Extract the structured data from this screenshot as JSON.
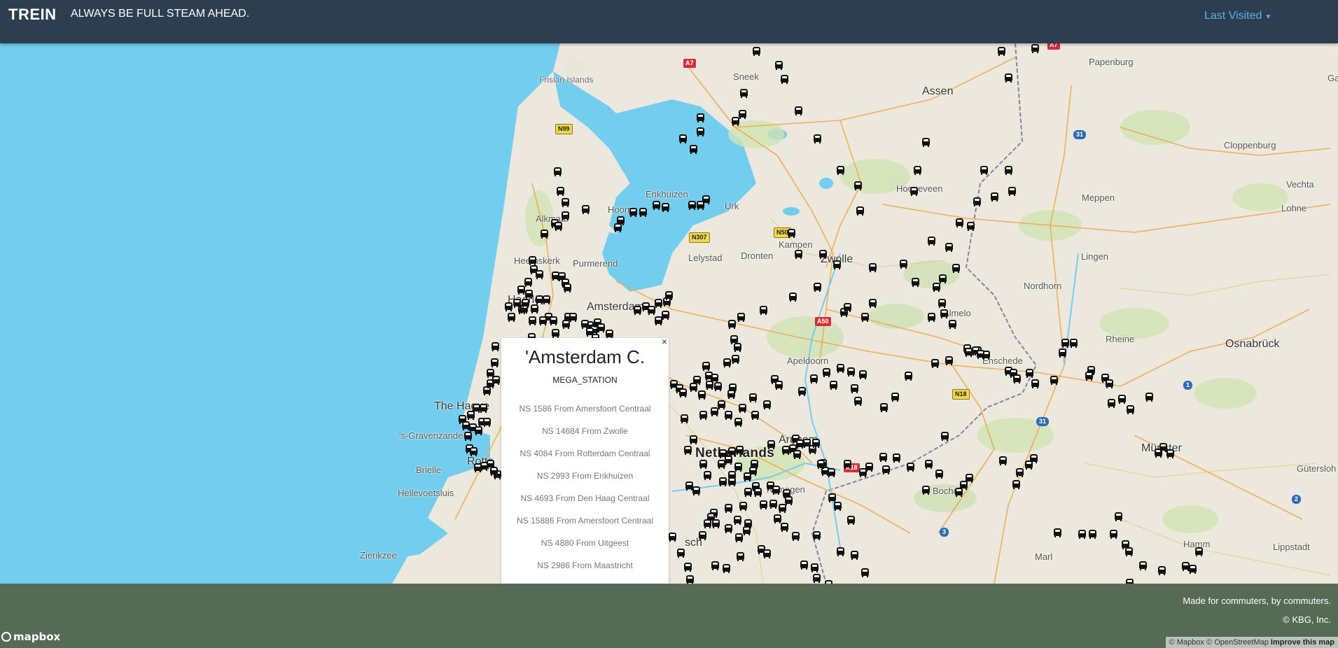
{
  "header": {
    "brand": "TREIN",
    "tagline": "ALWAYS BE FULL STEAM AHEAD.",
    "last_visited": "Last Visited"
  },
  "popup": {
    "close": "×",
    "title": "'Amsterdam C.",
    "type": "MEGA_STATION",
    "trains": [
      "NS 1586 From Amersfoort Centraal",
      "NS 14684 From Zwolle",
      "NS 4084 From Rotterdam Centraal",
      "NS 2993 From Enkhuizen",
      "NS 4693 From Den Haag Centraal",
      "NS 15886 From Amersfoort Centraal",
      "NS 4880 From Uitgeest",
      "NS 2986 From Maastricht"
    ]
  },
  "map": {
    "places": {
      "frisian_islands": "Frisian Islands",
      "sneek": "Sneek",
      "assen": "Assen",
      "papenburg": "Papenburg",
      "cloppenburg": "Cloppenburg",
      "vechta": "Vechta",
      "lohne": "Lohne",
      "meppen": "Meppen",
      "hoogeveen": "Hoogeveen",
      "enkhuizen": "Enkhuizen",
      "hoorn": "Hoorn",
      "urk": "Urk",
      "alkmaar": "Alkmaar",
      "lingen": "Lingen",
      "kampen": "Kampen",
      "zwolle": "Zwolle",
      "dronten": "Dronten",
      "lelystad": "Lelystad",
      "heemskerk": "Heemskerk",
      "purmerend": "Purmerend",
      "nordhorn": "Nordhorn",
      "haarlem": "Haarlem",
      "amsterdam": "Amsterdam",
      "almelo": "Almelo",
      "rheine": "Rheine",
      "osnabruck": "Osnabrück",
      "apeldoorn": "Apeldoorn",
      "enschede": "Enschede",
      "the_hague": "The Hague",
      "gravenzande": "'s-Gravenzande",
      "netherlands": "Netherlands",
      "arnhem": "Arnhem",
      "munster": "Münster",
      "gutersloh": "Gütersloh",
      "brielle": "Brielle",
      "rotterdam": "Rotte",
      "nijmegen": "Nijmegen",
      "bocholt": "Bocholt",
      "hellevoetsluis": "Hellevoetsluis",
      "zierikzee": "Zierikzee",
      "wesel": "sch",
      "marl": "Marl",
      "hamm": "Hamm",
      "lippstadt": "Lippstadt",
      "ga": "Ga"
    },
    "shields": {
      "a7_top": "A7",
      "a7_top2": "A7",
      "n99": "N99",
      "n307": "N307",
      "n50": "N50",
      "a50": "A50",
      "n18": "N18",
      "a18": "A18",
      "r31_1": "31",
      "r31_2": "31",
      "r1": "1",
      "r2": "2",
      "r3": "3"
    }
  },
  "footer": {
    "line1": "Made for commuters, by commuters.",
    "line2": "© KBG, Inc.",
    "mapbox": "mapbox",
    "attr_mapbox": "© Mapbox",
    "attr_osm": "© OpenStreetMap",
    "attr_improve": "Improve this map"
  }
}
